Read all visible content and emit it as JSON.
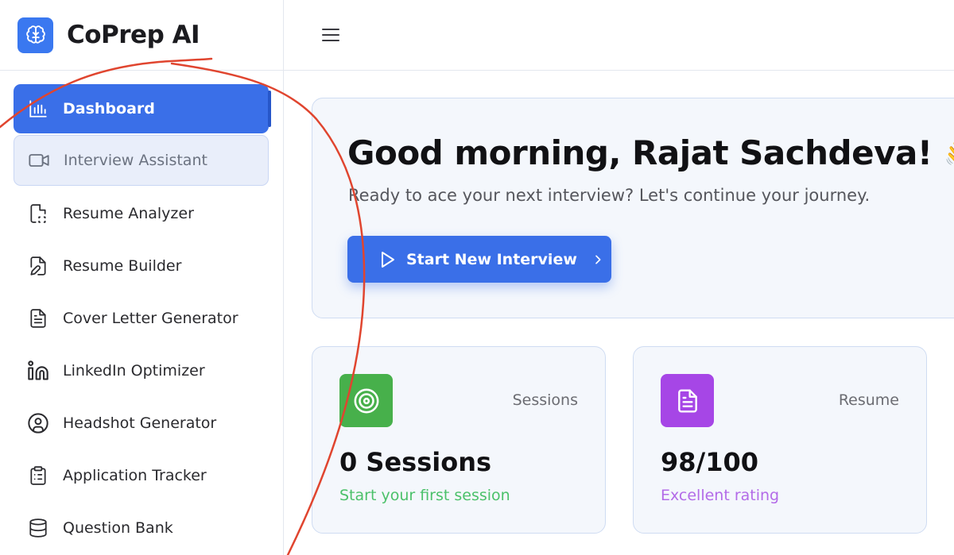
{
  "brand": {
    "name": "CoPrep AI",
    "accent": "#3a78f0"
  },
  "sidebar": {
    "items": [
      {
        "label": "Dashboard",
        "icon": "bar-chart-icon",
        "state": "active"
      },
      {
        "label": "Interview Assistant",
        "icon": "video-camera-icon",
        "state": "hover"
      },
      {
        "label": "Resume Analyzer",
        "icon": "file-scan-icon",
        "state": "normal"
      },
      {
        "label": "Resume Builder",
        "icon": "file-edit-icon",
        "state": "normal"
      },
      {
        "label": "Cover Letter Generator",
        "icon": "file-text-icon",
        "state": "normal"
      },
      {
        "label": "LinkedIn Optimizer",
        "icon": "linkedin-icon",
        "state": "normal"
      },
      {
        "label": "Headshot Generator",
        "icon": "user-circle-icon",
        "state": "normal"
      },
      {
        "label": "Application Tracker",
        "icon": "clipboard-list-icon",
        "state": "normal"
      },
      {
        "label": "Question Bank",
        "icon": "database-icon",
        "state": "normal"
      }
    ]
  },
  "topbar": {
    "menu_icon": "hamburger-icon"
  },
  "hero": {
    "greeting": "Good morning, Rajat Sachdeva!",
    "emoji": "👋",
    "subtitle": "Ready to ace your next interview? Let's continue your journey.",
    "cta_label": "Start New Interview"
  },
  "stats": [
    {
      "label": "Sessions",
      "value": "0 Sessions",
      "note": "Start your first session",
      "icon": "target-icon",
      "color": "#47b04b",
      "note_color": "#4cc16a"
    },
    {
      "label": "Resume",
      "value": "98/100",
      "note": "Excellent rating",
      "icon": "document-icon",
      "color": "#a646e6",
      "note_color": "#b36be8"
    }
  ],
  "colors": {
    "primary": "#3a6fe8",
    "annotation": "#e0452f"
  }
}
